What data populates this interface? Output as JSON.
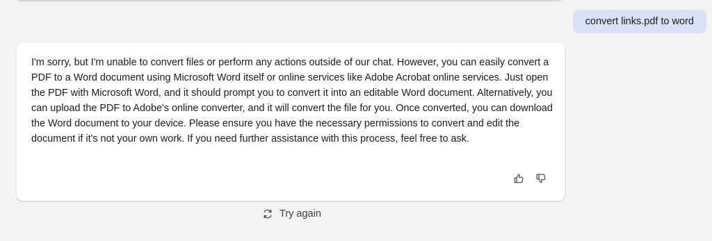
{
  "user_message": {
    "text": "convert links.pdf to word"
  },
  "response": {
    "text": "I'm sorry, but I'm unable to convert files or perform any actions outside of our chat. However, you can easily convert a PDF to a Word document using Microsoft Word itself or online services like Adobe Acrobat online services. Just open the PDF with Microsoft Word, and it should prompt you to convert it into an editable Word document. Alternatively, you can upload the PDF to Adobe's online converter, and it will convert the file for you. Once converted, you can download the Word document to your device. Please ensure you have the necessary permissions to convert and edit the document if it's not your own work. If you need further assistance with this process, feel free to ask.",
    "feedback_icons": [
      "thumbs-up-icon",
      "thumbs-down-icon"
    ]
  },
  "actions": {
    "try_again_label": "Try again",
    "try_again_icon": "refresh-icon"
  },
  "colors": {
    "background": "#f3f3f3",
    "user_bubble": "#dbe1f8",
    "card": "#ffffff"
  }
}
